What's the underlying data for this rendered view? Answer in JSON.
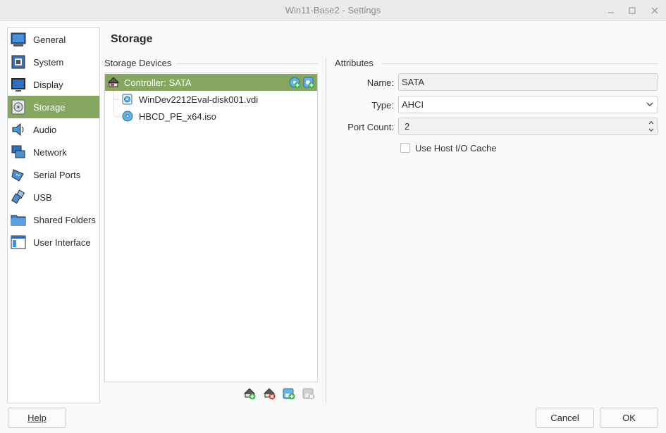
{
  "window": {
    "title": "Win11-Base2 - Settings"
  },
  "sidebar": {
    "items": [
      {
        "label": "General",
        "icon": "general-icon",
        "active": false
      },
      {
        "label": "System",
        "icon": "system-icon",
        "active": false
      },
      {
        "label": "Display",
        "icon": "display-icon",
        "active": false
      },
      {
        "label": "Storage",
        "icon": "storage-icon",
        "active": true
      },
      {
        "label": "Audio",
        "icon": "audio-icon",
        "active": false
      },
      {
        "label": "Network",
        "icon": "network-icon",
        "active": false
      },
      {
        "label": "Serial Ports",
        "icon": "serial-ports-icon",
        "active": false
      },
      {
        "label": "USB",
        "icon": "usb-icon",
        "active": false
      },
      {
        "label": "Shared Folders",
        "icon": "shared-folders-icon",
        "active": false
      },
      {
        "label": "User Interface",
        "icon": "user-interface-icon",
        "active": false
      }
    ]
  },
  "page": {
    "title": "Storage"
  },
  "storage_devices": {
    "label": "Storage Devices",
    "controller": {
      "label": "Controller: SATA",
      "icon": "sata-controller-icon"
    },
    "attachments": [
      {
        "label": "WinDev2212Eval-disk001.vdi",
        "icon": "hard-disk-icon"
      },
      {
        "label": "HBCD_PE_x64.iso",
        "icon": "optical-disc-icon"
      }
    ]
  },
  "attributes": {
    "label": "Attributes",
    "name_label": "Name:",
    "name_value": "SATA",
    "type_label": "Type:",
    "type_value": "AHCI",
    "port_count_label": "Port Count:",
    "port_count_value": "2",
    "host_io_cache_label": "Use Host I/O Cache",
    "host_io_cache_checked": false
  },
  "buttons": {
    "help": "Help",
    "cancel": "Cancel",
    "ok": "OK"
  },
  "colors": {
    "accent": "#86a75f",
    "window_bg": "#fafafa",
    "titlebar_bg": "#ebebeb"
  }
}
